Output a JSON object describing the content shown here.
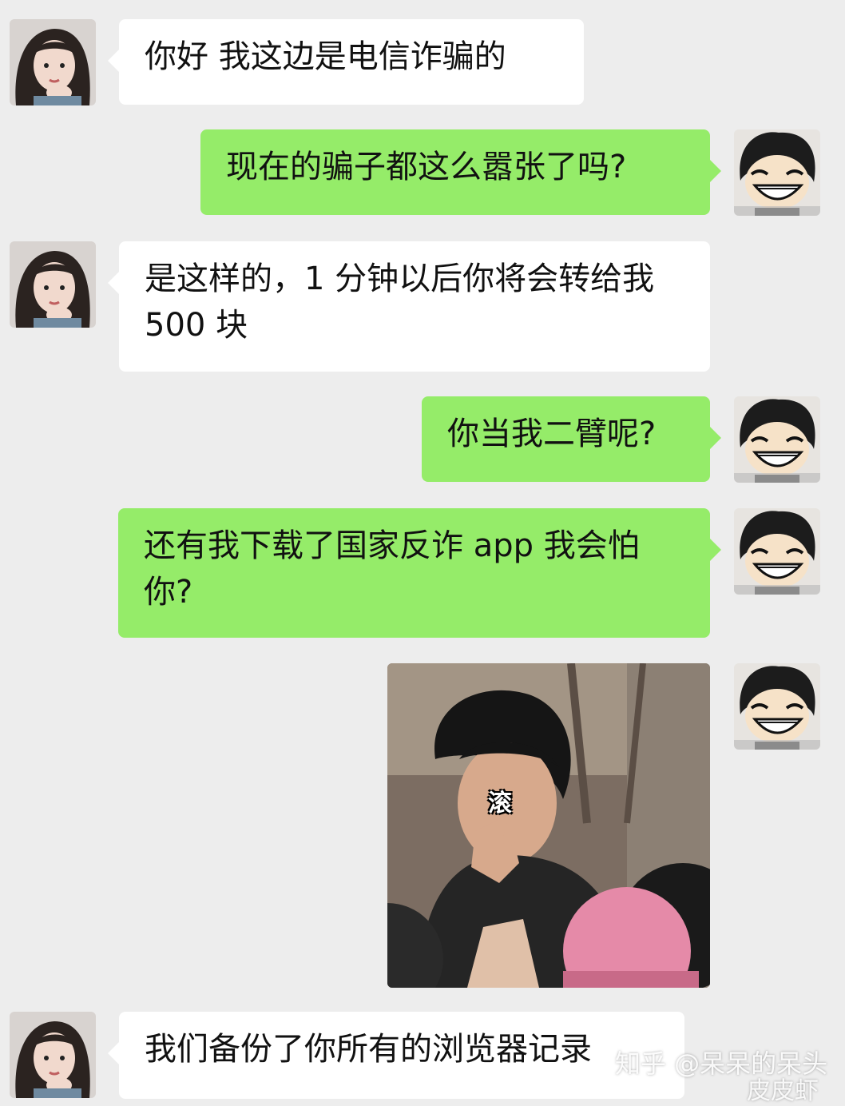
{
  "colors": {
    "background": "#ededed",
    "incoming_bubble": "#ffffff",
    "outgoing_bubble": "#95ec69"
  },
  "messages": [
    {
      "side": "in",
      "text": "你好 我这边是电信诈骗的"
    },
    {
      "side": "out",
      "text": "现在的骗子都这么嚣张了吗?"
    },
    {
      "side": "in",
      "text": "是这样的，1 分钟以后你将会转给我 500 块"
    },
    {
      "side": "out",
      "text": "你当我二臂呢?"
    },
    {
      "side": "out",
      "text": "还有我下载了国家反诈 app 我会怕你?"
    },
    {
      "side": "out",
      "type": "sticker",
      "caption": "滚"
    },
    {
      "side": "in",
      "text": "我们备份了你所有的浏览器记录"
    }
  ],
  "watermark": {
    "primary": "知乎 @呆呆的呆头",
    "secondary": "皮皮虾"
  },
  "avatars": {
    "incoming": "girl-avatar-icon",
    "outgoing": "cartoon-grin-avatar-icon"
  }
}
